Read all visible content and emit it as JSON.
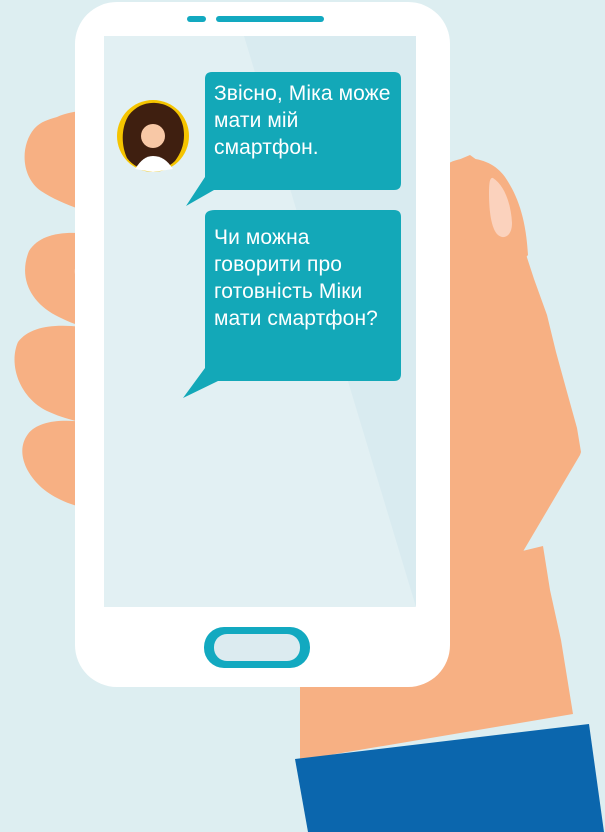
{
  "colors": {
    "background": "#ddeef1",
    "phone_body": "#ffffff",
    "screen": "#d9ebf0",
    "bubble": "#13a8b8",
    "skin": "#f7b083",
    "skin_light": "#fbd2bd",
    "sleeve": "#0b66ad",
    "avatar_ring": "#f5c400"
  },
  "icons": {
    "avatar": "woman-avatar-icon",
    "home_button": "home-button-icon",
    "speaker": "speaker-slot-icon"
  },
  "chat": {
    "messages": [
      {
        "sender": "incoming",
        "text": "Звісно, Міка може мати мій смартфон."
      },
      {
        "sender": "incoming",
        "text": "Чи можна говорити про готовність Міки мати смартфон?"
      }
    ]
  }
}
